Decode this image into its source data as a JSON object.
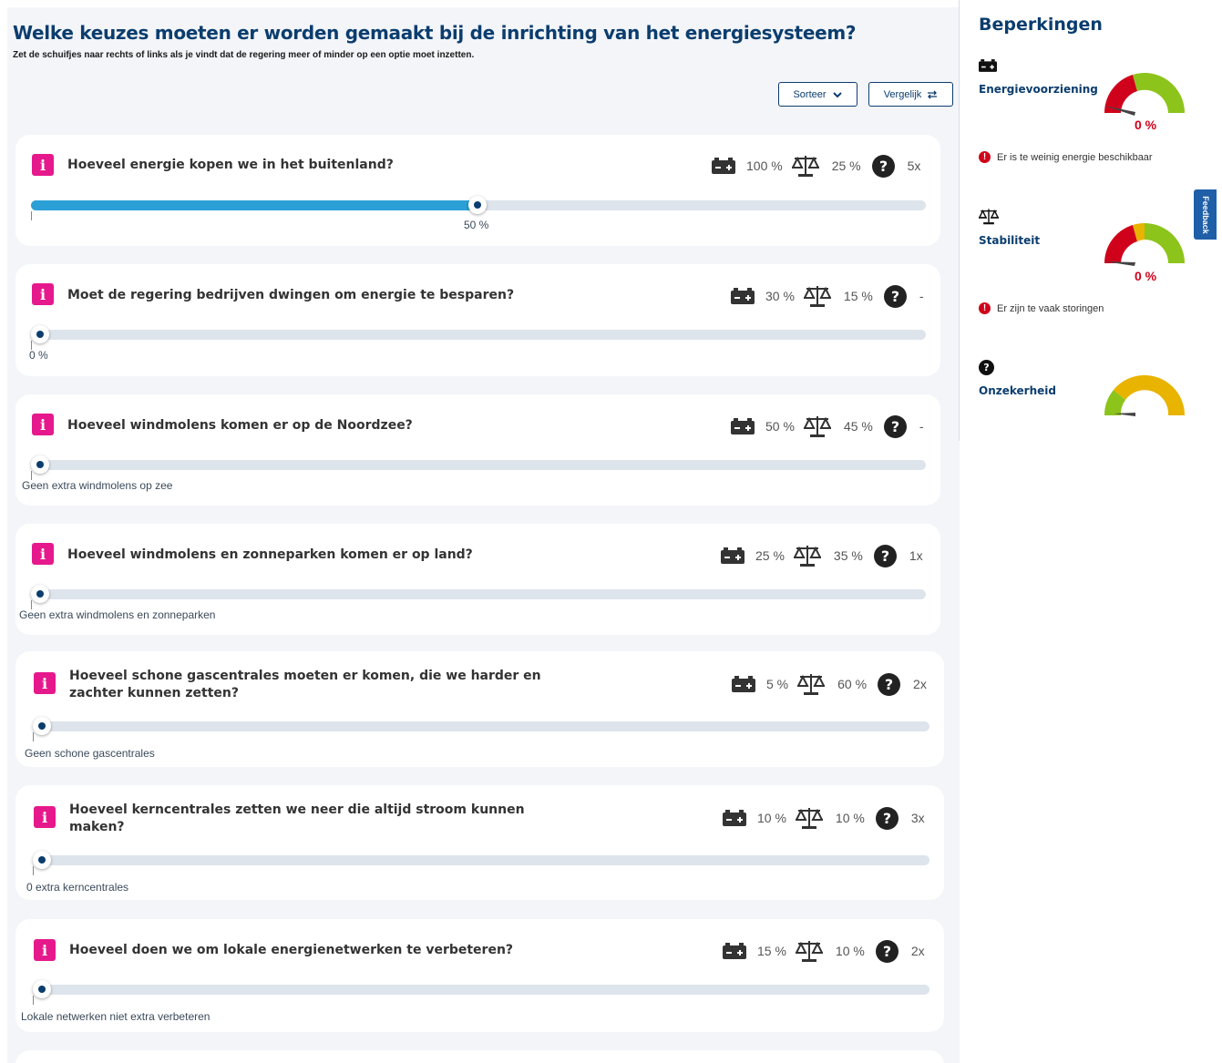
{
  "header": {
    "title": "Welke keuzes moeten er worden gemaakt bij de inrichting van het energiesysteem?",
    "subtitle": "Zet de schuifjes naar rechts of links als je vindt dat de regering meer of minder op een optie moet inzetten."
  },
  "toolbar": {
    "sort_label": "Sorteer",
    "compare_label": "Vergelijk"
  },
  "questions": [
    {
      "text": "Hoeveel energie kopen we in het buitenland?",
      "energy": "100 %",
      "stability": "25 %",
      "uncertainty": "5x",
      "slider_value": 50,
      "slider_label": "50 %"
    },
    {
      "text": "Moet de regering bedrijven dwingen om energie te besparen?",
      "energy": "30 %",
      "stability": "15 %",
      "uncertainty": "-",
      "slider_value": 0,
      "slider_label": "0 %"
    },
    {
      "text": "Hoeveel windmolens komen er op de Noordzee?",
      "energy": "50 %",
      "stability": "45 %",
      "uncertainty": "-",
      "slider_value": 0,
      "slider_label": "Geen extra windmolens op zee"
    },
    {
      "text": "Hoeveel windmolens en zonneparken komen er op land?",
      "energy": "25 %",
      "stability": "35 %",
      "uncertainty": "1x",
      "slider_value": 0,
      "slider_label": "Geen extra windmolens en zonneparken"
    },
    {
      "text_line1": "Hoeveel schone gascentrales moeten er komen, die we harder en",
      "text_line2": "zachter kunnen zetten?",
      "energy": "5 %",
      "stability": "60 %",
      "uncertainty": "2x",
      "slider_value": 0,
      "slider_label": "Geen schone gascentrales"
    },
    {
      "text_line1": "Hoeveel kerncentrales zetten we neer die altijd stroom kunnen",
      "text_line2": "maken?",
      "energy": "10 %",
      "stability": "10 %",
      "uncertainty": "3x",
      "slider_value": 0,
      "slider_label": "0 extra kerncentrales"
    },
    {
      "text": "Hoeveel doen we om lokale energienetwerken te verbeteren?",
      "energy": "15 %",
      "stability": "10 %",
      "uncertainty": "2x",
      "slider_value": 0,
      "slider_label": "Lokale netwerken niet extra verbeteren"
    }
  ],
  "panel": {
    "title": "Beperkingen",
    "constraints": [
      {
        "label": "Energievoorziening",
        "value": "0 %",
        "warning": "Er is te weinig energie beschikbaar"
      },
      {
        "label": "Stabiliteit",
        "value": "0 %",
        "warning": "Er zijn te vaak storingen"
      },
      {
        "label": "Onzekerheid"
      }
    ]
  },
  "feedback_label": "Feedback",
  "colors": {
    "title": "#0b3d6e",
    "info_badge": "#e6198c",
    "slider_fill": "#2aa0d6",
    "gauge_red": "#d0021b",
    "gauge_green": "#8cc41b",
    "gauge_yellow": "#e8b400"
  }
}
